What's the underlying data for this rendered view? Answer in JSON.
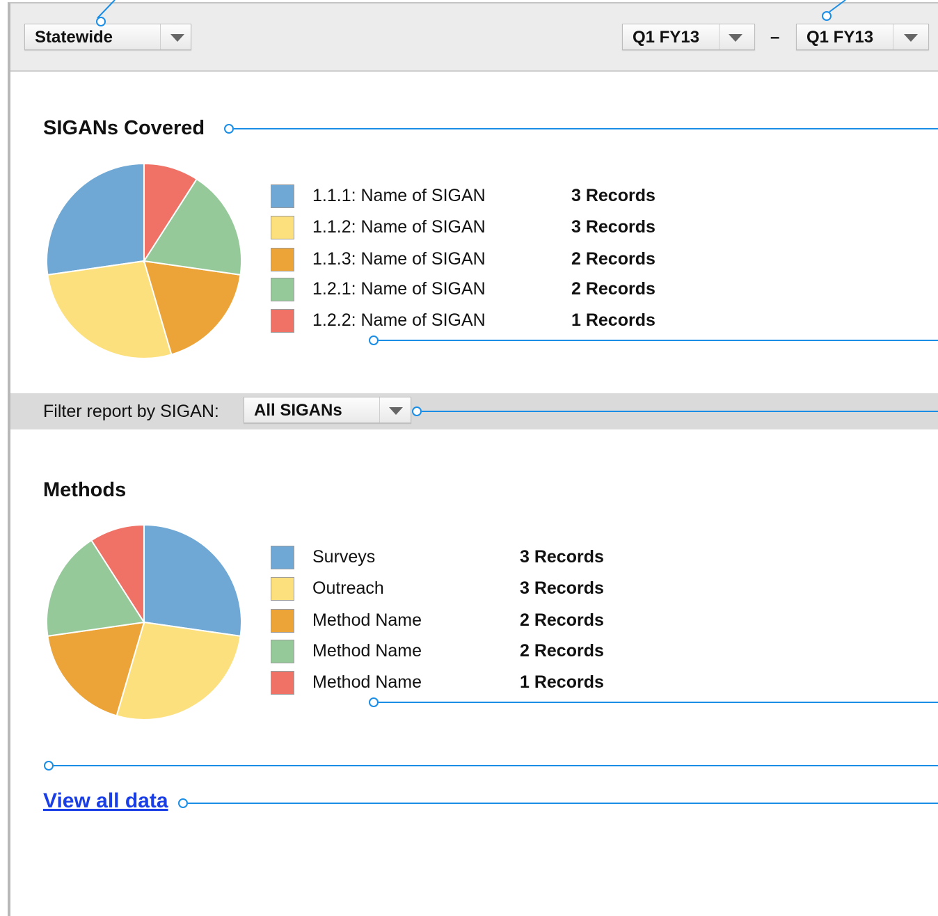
{
  "header": {
    "region": {
      "value": "Statewide"
    },
    "period_from": {
      "value": "Q1 FY13"
    },
    "separator": "–",
    "period_to": {
      "value": "Q1 FY13"
    }
  },
  "sigans": {
    "title": "SIGANs Covered",
    "items": [
      {
        "label": "1.1.1: Name of SIGAN",
        "count": "3 Records",
        "color": "#6fa8d4"
      },
      {
        "label": "1.1.2: Name of SIGAN",
        "count": "3 Records",
        "color": "#fde07e"
      },
      {
        "label": "1.1.3: Name of SIGAN",
        "count": "2 Records",
        "color": "#eca438"
      },
      {
        "label": "1.2.1: Name of SIGAN",
        "count": "2 Records",
        "color": "#95c99a"
      },
      {
        "label": "1.2.2: Name of SIGAN",
        "count": "1 Records",
        "color": "#f07266"
      }
    ]
  },
  "filter": {
    "label": "Filter report by SIGAN:",
    "value": "All SIGANs"
  },
  "methods": {
    "title": "Methods",
    "items": [
      {
        "label": "Surveys",
        "count": "3 Records",
        "color": "#6fa8d4"
      },
      {
        "label": "Outreach",
        "count": "3 Records",
        "color": "#fde07e"
      },
      {
        "label": "Method Name",
        "count": "2 Records",
        "color": "#eca438"
      },
      {
        "label": "Method Name",
        "count": "2 Records",
        "color": "#95c99a"
      },
      {
        "label": "Method Name",
        "count": "1 Records",
        "color": "#f07266"
      }
    ]
  },
  "view_all_link": "View all data",
  "chart_data": [
    {
      "type": "pie",
      "title": "SIGANs Covered",
      "categories": [
        "1.1.1: Name of SIGAN",
        "1.1.2: Name of SIGAN",
        "1.1.3: Name of SIGAN",
        "1.2.1: Name of SIGAN",
        "1.2.2: Name of SIGAN"
      ],
      "values": [
        3,
        3,
        2,
        2,
        1
      ],
      "colors": [
        "#6fa8d4",
        "#fde07e",
        "#eca438",
        "#95c99a",
        "#f07266"
      ]
    },
    {
      "type": "pie",
      "title": "Methods",
      "categories": [
        "Surveys",
        "Outreach",
        "Method Name",
        "Method Name",
        "Method Name"
      ],
      "values": [
        3,
        3,
        2,
        2,
        1
      ],
      "colors": [
        "#6fa8d4",
        "#fde07e",
        "#eca438",
        "#95c99a",
        "#f07266"
      ]
    }
  ]
}
